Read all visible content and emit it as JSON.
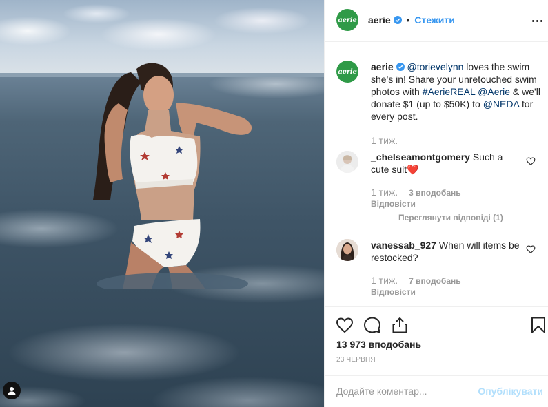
{
  "post": {
    "brand_logo_text": "aerie",
    "username": "aerie",
    "follow_label": "Стежити",
    "separator": "•"
  },
  "caption": {
    "username": "aerie",
    "mention1": "@torievelynn",
    "text1": " loves the swim she's in! Share your unretouched swim photos with ",
    "hashtag": "#AerieREAL",
    "space": " ",
    "mention2": "@Aerie",
    "text2": " & we'll donate $1 (up to $50K) to ",
    "mention3": "@NEDA",
    "text3": " for every post.",
    "time": "1 тиж."
  },
  "comments": [
    {
      "username": "_chelseamontgomery",
      "text": "Such a cute suit",
      "emoji": "❤️",
      "time": "1 тиж.",
      "likes": "3 вподобань",
      "reply_label": "Відповісти",
      "view_replies": "Переглянути відповіді (1)"
    },
    {
      "username": "vanessab_927",
      "text": "When will items be restocked?",
      "time": "1 тиж.",
      "likes": "7 вподобань",
      "reply_label": "Відповісти"
    }
  ],
  "actions": {
    "likes_count": "13 973 вподобань",
    "date": "23 ЧЕРВНЯ"
  },
  "add_comment": {
    "placeholder": "Додайте коментар...",
    "publish_label": "Опублікувати"
  },
  "colors": {
    "brand_green": "#2f9a47",
    "link_blue": "#3897f0",
    "mention_navy": "#003569",
    "muted": "#999999",
    "publish_disabled": "#b2dffc"
  },
  "icons": [
    "verified-badge-icon",
    "more-options-icon",
    "heart-icon",
    "comment-icon",
    "share-icon",
    "bookmark-icon"
  ]
}
